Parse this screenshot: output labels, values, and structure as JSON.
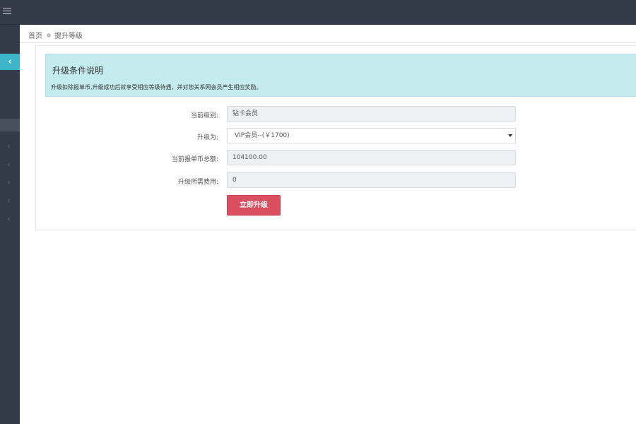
{
  "breadcrumb": {
    "home": "首页",
    "current": "提升等级"
  },
  "notice": {
    "title": "升级条件说明",
    "description": "升级扣除报单币,升级成功后就享受相应等级待遇，并对您关系网会员产生相应奖励。"
  },
  "form": {
    "current_level_label": "当前级别:",
    "current_level_value": "钻卡会员",
    "upgrade_to_label": "升级为:",
    "upgrade_to_value": "VIP会员--(￥1700)",
    "balance_label": "当前报单币总额:",
    "balance_value": "104100.00",
    "fee_label": "升级所需费用:",
    "fee_value": "0",
    "submit_label": "立即升级"
  },
  "icons": {
    "menu": "hamburger-icon",
    "collapse": "chevron-left-icon",
    "nav_arrow": "chevron-left-icon",
    "select_caret": "caret-down-icon"
  },
  "colors": {
    "topbar": "#333a48",
    "accent": "#3db5c9",
    "notice_bg": "#c4ecee",
    "button": "#da4f5f"
  }
}
